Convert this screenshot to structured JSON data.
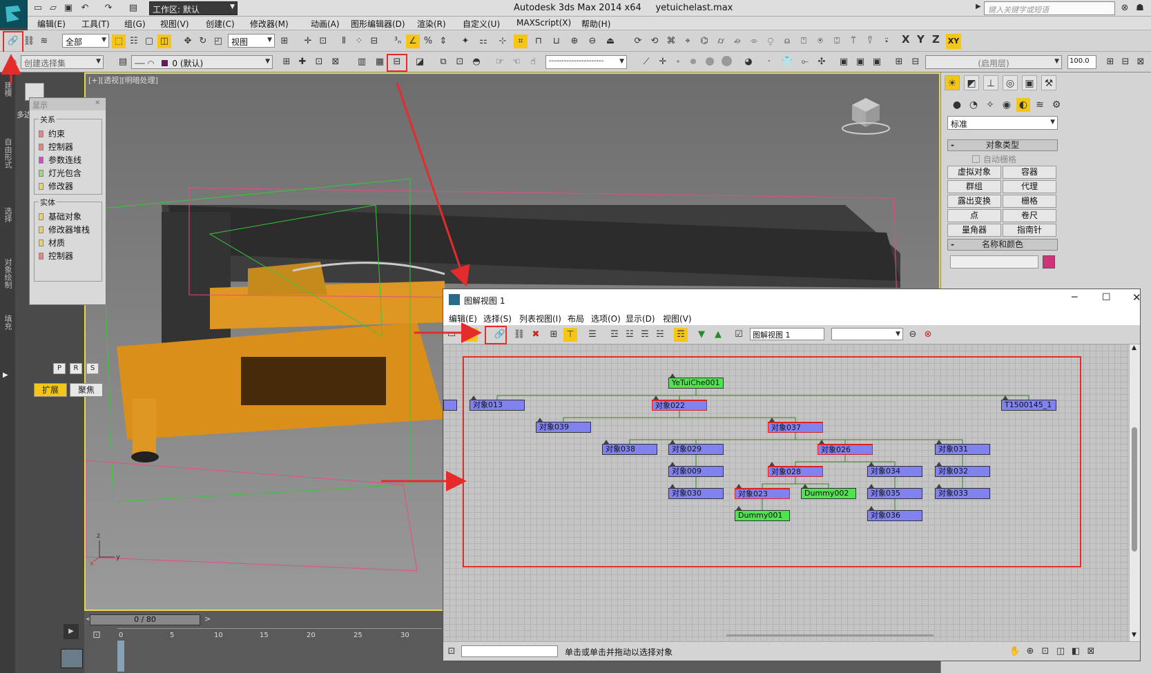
{
  "app": {
    "title": "Autodesk 3ds Max  2014 x64",
    "file": "yetuichelast.max",
    "workspace": "工作区: 默认",
    "search_placeholder": "键入关键字或短语"
  },
  "menu": [
    "编辑(E)",
    "工具(T)",
    "组(G)",
    "视图(V)",
    "创建(C)",
    "修改器(M)",
    "动画(A)",
    "图形编辑器(D)",
    "渲染(R)",
    "自定义(U)",
    "MAXScript(X)",
    "帮助(H)"
  ],
  "toolbar": {
    "selection_filter": "全部",
    "ref_coord": "视图",
    "named_selection": "创建选择集",
    "layer": "0 (默认)",
    "layer_color": "#7a0a7a",
    "axis_x": "X",
    "axis_y": "Y",
    "axis_z": "Z",
    "axis_xy": "XY",
    "blank_dropdown": "----------------------",
    "enabled_layer": "(启用层)",
    "percent": "100.0"
  },
  "left_tabs": [
    "建模",
    "自由形式",
    "选择",
    "对象绘制",
    "填充"
  ],
  "viewport": {
    "label": "[+][透视][明暗处理]",
    "frame": "0 / 80",
    "ticks": [
      "0",
      "5",
      "10",
      "15",
      "20",
      "25",
      "30"
    ]
  },
  "left_panel_label": "多边",
  "display_panel": {
    "title": "显示",
    "relations_title": "关系",
    "relations": [
      {
        "label": "约束",
        "color": "#f08080"
      },
      {
        "label": "控制器",
        "color": "#f08080"
      },
      {
        "label": "参数连线",
        "color": "#e040e0"
      },
      {
        "label": "灯光包含",
        "color": "#9ad58a"
      },
      {
        "label": "修改器",
        "color": "#f0d060"
      }
    ],
    "entities_title": "实体",
    "entities": [
      {
        "label": "基础对象",
        "color": "#f0d060"
      },
      {
        "label": "修改器堆栈",
        "color": "#f0d060"
      },
      {
        "label": "材质",
        "color": "#f0d060"
      },
      {
        "label": "控制器",
        "color": "#f08080"
      }
    ],
    "prs": [
      "P",
      "R",
      "S"
    ],
    "expand": "扩展",
    "focus": "聚焦"
  },
  "command_panel": {
    "category": "标准",
    "object_type": "对象类型",
    "autogrid": "自动栅格",
    "buttons": [
      "虚拟对象",
      "容器",
      "群组",
      "代理",
      "露出变换",
      "栅格",
      "点",
      "卷尺",
      "量角器",
      "指南针"
    ],
    "name_color": "名称和颜色",
    "swatch": "#d0337a"
  },
  "schematic": {
    "title": "图解视图 1",
    "menu": [
      "编辑(E)",
      "选择(S)",
      "列表视图(I)",
      "布局",
      "选项(O)",
      "显示(D)",
      "视图(V)"
    ],
    "view_name": "图解视图 1",
    "status": "单击或单击并拖动以选择对象",
    "nodes": [
      {
        "label": "YeTuiChe001",
        "color": "green"
      },
      {
        "label": "对象013",
        "color": "blue"
      },
      {
        "label": "对象022",
        "color": "blue",
        "sel": true
      },
      {
        "label": "T1500145_1",
        "color": "blue"
      },
      {
        "label": "对象039",
        "color": "blue"
      },
      {
        "label": "对象037",
        "color": "blue",
        "sel": true
      },
      {
        "label": "对象038",
        "color": "blue"
      },
      {
        "label": "对象029",
        "color": "blue"
      },
      {
        "label": "对象026",
        "color": "blue",
        "sel": true
      },
      {
        "label": "对象031",
        "color": "blue"
      },
      {
        "label": "对象009",
        "color": "blue"
      },
      {
        "label": "对象028",
        "color": "blue",
        "sel": true
      },
      {
        "label": "对象034",
        "color": "blue"
      },
      {
        "label": "对象032",
        "color": "blue"
      },
      {
        "label": "对象030",
        "color": "blue"
      },
      {
        "label": "对象023",
        "color": "blue",
        "sel": true
      },
      {
        "label": "Dummy002",
        "color": "green"
      },
      {
        "label": "对象035",
        "color": "blue"
      },
      {
        "label": "对象033",
        "color": "blue"
      },
      {
        "label": "Dummy001",
        "color": "green"
      },
      {
        "label": "对象036",
        "color": "blue"
      }
    ]
  },
  "colors": {
    "annotation": "#e52b2b",
    "viewport_border": "#e8d84a"
  }
}
